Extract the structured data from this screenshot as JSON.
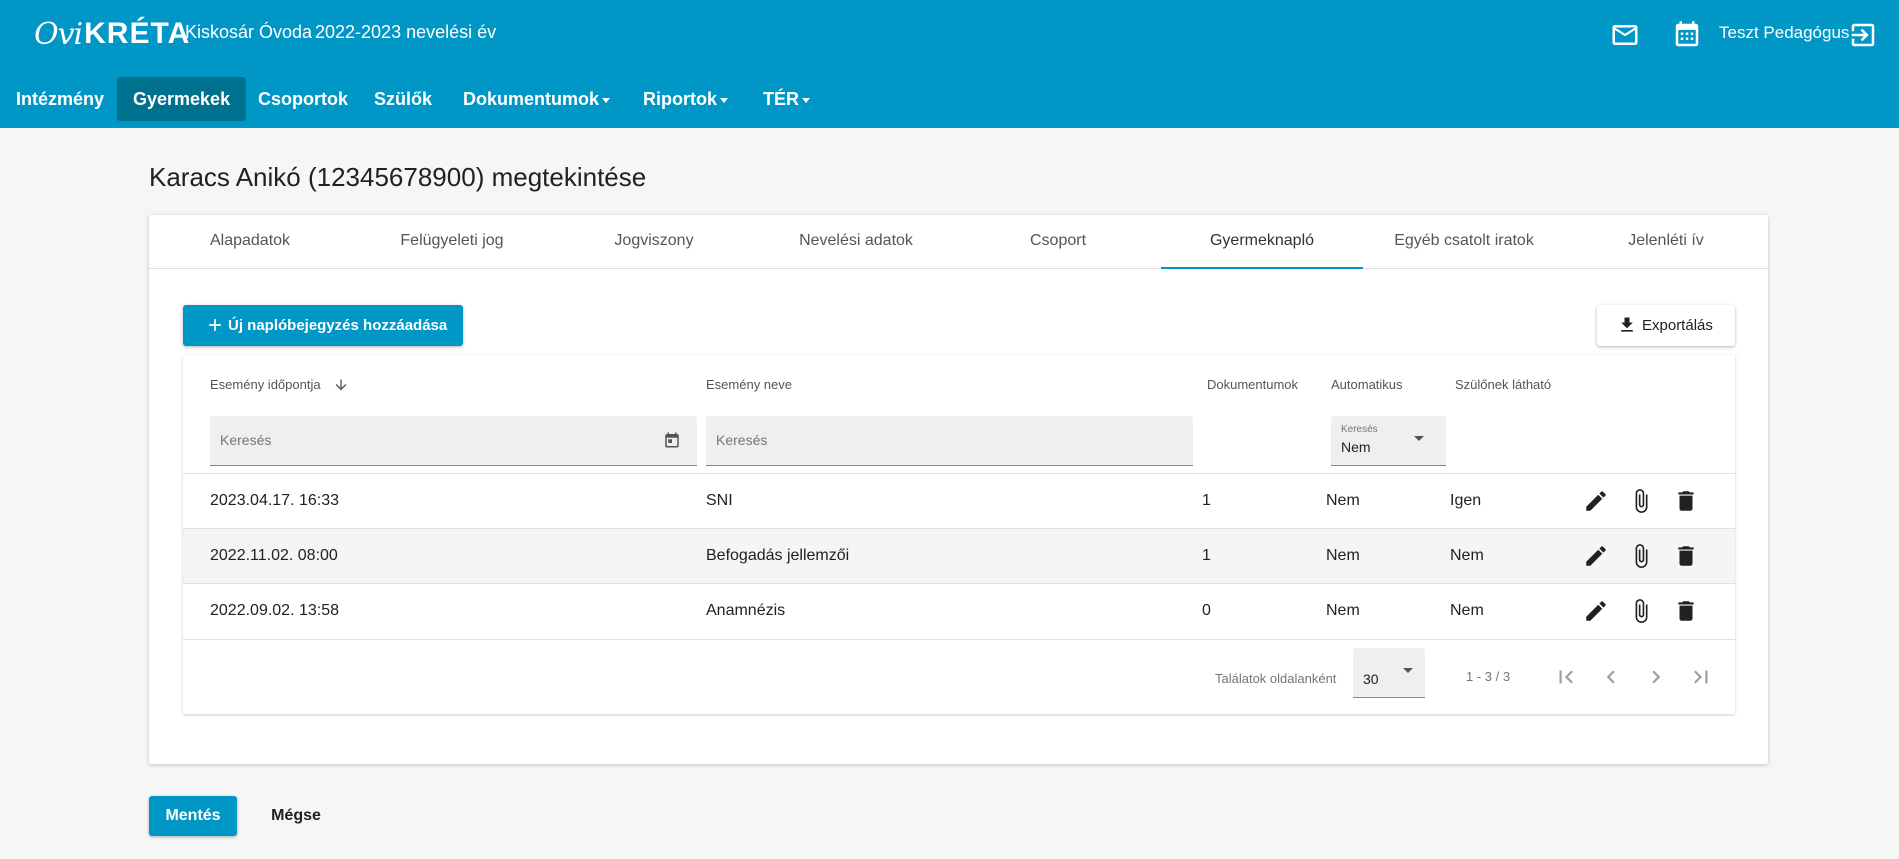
{
  "header": {
    "logo_text_script": "Ovi",
    "logo_text": "KRÉTA",
    "institution": "Kiskosár Óvoda",
    "school_year": "2022-2023 nevelési év",
    "user_name": "Teszt Pedagógus",
    "icons": {
      "mail": "mail-icon",
      "calendar": "calendar-icon",
      "logout": "logout-icon"
    }
  },
  "nav": {
    "items": [
      {
        "label": "Intézmény"
      },
      {
        "label": "Gyermekek",
        "active": true
      },
      {
        "label": "Csoportok"
      },
      {
        "label": "Szülők"
      },
      {
        "label": "Dokumentumok"
      },
      {
        "label": "Riportok"
      },
      {
        "label": "TÉR"
      }
    ]
  },
  "page": {
    "title": "Karacs Anikó (12345678900) megtekintése"
  },
  "tabs": [
    {
      "label": "Alapadatok"
    },
    {
      "label": "Felügyeleti jog"
    },
    {
      "label": "Jogviszony"
    },
    {
      "label": "Nevelési adatok"
    },
    {
      "label": "Csoport"
    },
    {
      "label": "Gyermeknapló",
      "active": true
    },
    {
      "label": "Egyéb csatolt iratok"
    },
    {
      "label": "Jelenléti ív"
    }
  ],
  "actions": {
    "add_label": "Új naplóbejegyzés hozzáadása",
    "export_label": "Exportálás"
  },
  "table": {
    "headers": {
      "date": "Esemény időpontja",
      "name": "Esemény neve",
      "docs": "Dokumentumok",
      "auto": "Automatikus",
      "visible": "Szülőnek látható"
    },
    "filters": {
      "date_placeholder": "Keresés",
      "name_placeholder": "Keresés",
      "auto_label": "Keresés",
      "auto_value": "Nem"
    },
    "rows": [
      {
        "date": "2023.04.17. 16:33",
        "name": "SNI",
        "docs": "1",
        "auto": "Nem",
        "visible": "Igen"
      },
      {
        "date": "2022.11.02. 08:00",
        "name": "Befogadás jellemzői",
        "docs": "1",
        "auto": "Nem",
        "visible": "Nem"
      },
      {
        "date": "2022.09.02. 13:58",
        "name": "Anamnézis",
        "docs": "0",
        "auto": "Nem",
        "visible": "Nem"
      }
    ],
    "pagination": {
      "per_page_label": "Találatok oldalanként",
      "per_page_value": "30",
      "range": "1 - 3 / 3"
    }
  },
  "footer": {
    "save_label": "Mentés",
    "cancel_label": "Mégse"
  },
  "colors": {
    "brand": "#0097c7",
    "nav_active": "#00708f"
  }
}
